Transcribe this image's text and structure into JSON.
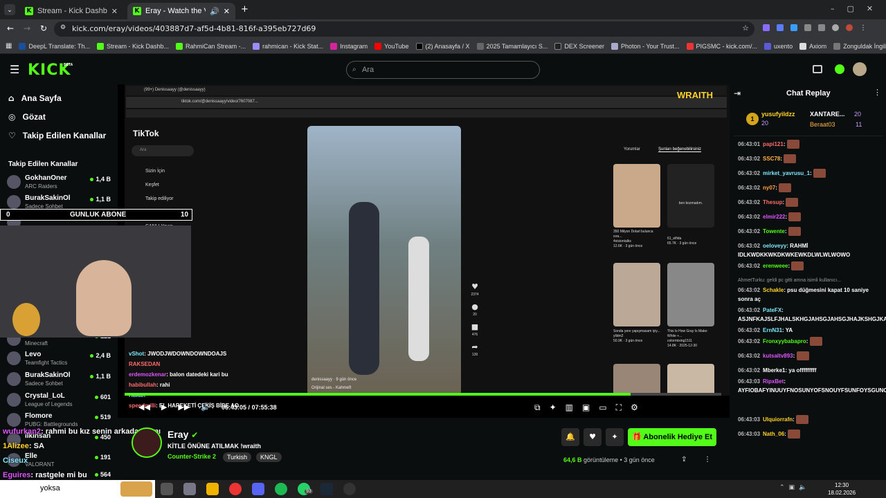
{
  "browser": {
    "tabs": [
      {
        "label": "Stream - Kick Dashboard"
      },
      {
        "label": "Eray - Watch the VOD on K"
      }
    ],
    "url": "kick.com/eray/videos/403887d7-af5d-4b81-816f-a395eb727d69",
    "bookmarks": [
      "DeepL Translate: Th...",
      "Stream - Kick Dashb...",
      "RahmiCan Stream -...",
      "rahmican - Kick Stat...",
      "Instagram",
      "YouTube",
      "(2) Anasayfa / X",
      "2025 Tamamlayıcı S...",
      "DEX Screener",
      "Photon - Your Trust...",
      "PIGSMC - kick.com/...",
      "uxento",
      "Axiom",
      "Zonguldak İngilizce..."
    ]
  },
  "header": {
    "logo": "KICK",
    "beta": "BETA",
    "search_placeholder": "Ara"
  },
  "sidebar": {
    "nav": [
      {
        "label": "Ana Sayfa",
        "icon": "home-icon"
      },
      {
        "label": "Gözat",
        "icon": "compass-icon"
      },
      {
        "label": "Takip Edilen Kanallar",
        "icon": "heart-icon"
      }
    ],
    "section_title": "Takip Edilen Kanallar",
    "channels": [
      {
        "name": "GokhanOner",
        "game": "ARC Raiders",
        "viewers": "1,4 B"
      },
      {
        "name": "BurakSakinOl",
        "game": "Sadece Sohbet",
        "viewers": "1,1 B"
      },
      {
        "name": "Flomore",
        "game": "",
        "viewers": ""
      },
      {
        "name": "kaoriiol",
        "game": "Minecraft",
        "viewers": "121"
      },
      {
        "name": "Levo",
        "game": "Teamfight Tactics",
        "viewers": "2,4 B"
      },
      {
        "name": "BurakSakinOl",
        "game": "Sadece Sohbet",
        "viewers": "1,1 B"
      },
      {
        "name": "Crystal_LoL",
        "game": "League of Legends",
        "viewers": "601"
      },
      {
        "name": "Flomore",
        "game": "PUBG: Battlegrounds",
        "viewers": "519"
      },
      {
        "name": "ilkinsan",
        "game": "",
        "viewers": "450"
      },
      {
        "name": "Elle",
        "game": "VALORANT",
        "viewers": "191"
      },
      {
        "name": "",
        "game": "",
        "viewers": "564"
      }
    ]
  },
  "overlay": {
    "sub_goal": {
      "left": "0",
      "label": "GUNLUK ABONE",
      "right": "10"
    },
    "watermark": "WRAITH",
    "chat_lines": [
      {
        "user": "vShot",
        "text": "JWODJWDOWNDOWNDOAJS"
      },
      {
        "user": "RAKSEDAN",
        "text": ""
      },
      {
        "user": "erdemozkenar",
        "text": "balon datedeki kari bu"
      },
      {
        "user": "habibullah",
        "text": "rahi"
      },
      {
        "user": "Hakan",
        "text": ""
      },
      {
        "user": "speedmilli",
        "text": "EL HAREKETİ ÇEKİŞ BİDE AO"
      },
      {
        "user": "wufurkan2",
        "text": "rahmi bu kız senin arkadaşın mı"
      },
      {
        "user": "1Alizee",
        "text": "SA"
      },
      {
        "user": "Ciseux",
        "text": ""
      },
      {
        "user": "Eguires",
        "text": "rastgele mi bu"
      }
    ]
  },
  "tiktok": {
    "tab_title": "(99+) Denissaayy (@denissaayy)",
    "url": "tiktok.com/@denissaayy/video/7607087...",
    "logo": "TikTok",
    "search": "Ara",
    "menu": [
      "Sizin İçin",
      "Keşfet",
      "Takip ediliyor",
      "Arkadaşlar",
      "CANLI Yayın"
    ],
    "right_tabs": [
      "Yorumlar",
      "Şunları beğenebilirsiniz"
    ],
    "video_user": "denissaayy",
    "video_ago": "9 gün önce",
    "sound": "Orijinal ses - Kahmeft",
    "side_counts": [
      "2374",
      "20",
      "476",
      "139"
    ],
    "cards": [
      {
        "title": "350 Milyon Dolarl bulunca sıra...",
        "user": "4visiontalks",
        "meta": "12.6K · 3 gün önce"
      },
      {
        "title": "ben bozmadım.",
        "user": "61_elfida",
        "meta": "65.7K · 3 gün önce"
      },
      {
        "title": "Sonda yere yapışmasam iyiy...",
        "user": "ylldm2",
        "meta": "50.9K · 3 gün önce"
      },
      {
        "title": "This Is How Gray Is Make: White +...",
        "user": "colormixing1511",
        "meta": "14.8K · 2025-12-30"
      }
    ]
  },
  "player": {
    "current": "06:43:05",
    "total": "07:55:38",
    "progress": 0.848
  },
  "streamer": {
    "name": "Eray",
    "title": "KİTLE ÖNÜNE ATILMAK !wraith",
    "category": "Counter-Strike 2",
    "tags": [
      "Turkish",
      "KNGL"
    ],
    "views": "64,6 B",
    "views_label": "görüntüleme",
    "ago": "3 gün önce",
    "gift_button": "Abonelik Hediye Et"
  },
  "chat": {
    "title": "Chat Replay",
    "top": {
      "rank": "1",
      "user1": "yusufyildzz",
      "score1": "20",
      "user2": "XANTARE...",
      "score2": "20",
      "user3": "Beraat03",
      "score3": "11"
    },
    "messages": [
      {
        "t": "06:43:01",
        "user": "papi121",
        "color": "#ff6b6b",
        "text": ""
      },
      {
        "t": "06:43:02",
        "user": "SSC78",
        "color": "#ffb347",
        "text": ""
      },
      {
        "t": "06:43:02",
        "user": "mirket_yavrusu_1",
        "color": "#7ee8fa",
        "text": ""
      },
      {
        "t": "06:43:02",
        "user": "ny07",
        "color": "#ff9f43",
        "text": ""
      },
      {
        "t": "06:43:02",
        "user": "Thesup",
        "color": "#ff6b6b",
        "text": ""
      },
      {
        "t": "06:43:02",
        "user": "elmir222",
        "color": "#e056fd",
        "text": ""
      },
      {
        "t": "06:43:02",
        "user": "Towente",
        "color": "#53fc18",
        "text": ""
      },
      {
        "t": "06:43:02",
        "user": "oeloveyy",
        "color": "#7ee8fa",
        "text": "RAHMİ IDLKWDKKWKDKWKEWKDLWLWLWOWO"
      },
      {
        "t": "06:43:02",
        "user": "erenweee",
        "color": "#53fc18",
        "text": ""
      },
      {
        "t": "06:43:02",
        "user": "Schakle",
        "color": "#ffd32a",
        "text": "psu düğmesini kapat 10 saniye sonra aç"
      },
      {
        "t": "06:43:02",
        "user": "PateFX",
        "color": "#7ee8fa",
        "text": "ASJNFKAJSLFJHALSKHGJAHSGJAHSGJHAJKSHGJKAHSJKHGAJKS"
      },
      {
        "t": "06:43:02",
        "user": "ErnN31",
        "color": "#7ee8fa",
        "text": "YA"
      },
      {
        "t": "06:43:02",
        "user": "Fronxyybabapro",
        "color": "#53fc18",
        "text": ""
      },
      {
        "t": "06:43:02",
        "user": "kutsaltv893",
        "color": "#e056fd",
        "text": ""
      },
      {
        "t": "06:43:02",
        "user": "Mberke1",
        "color": "#fff",
        "text": "ya offfffffff"
      },
      {
        "t": "06:43:03",
        "user": "RipxBet",
        "color": "#e056fd",
        "text": "AYFIOBAFYINUUYFNOSUNYOFSNOUYFSUNFOYSGUNOSYUFISBIFUYFUBYSBIYFSFBYIABUOFYBFYUIABFUYIABUYIAFUYBOABIFUYNUOFYANUOYFAUTNAY!"
      },
      {
        "t": "06:43:03",
        "user": "Ulquiorrafn",
        "color": "#ffd32a",
        "text": ""
      },
      {
        "t": "06:43:03",
        "user": "Nath_06",
        "color": "#ffd32a",
        "text": ""
      }
    ],
    "reply_note": "AhmetTurku: geldi pc gitti amna isimli kullanıcı..."
  },
  "taskbar": {
    "search": "yoksa",
    "time": "12:30",
    "date": "18.02.2026",
    "badge": "93"
  }
}
